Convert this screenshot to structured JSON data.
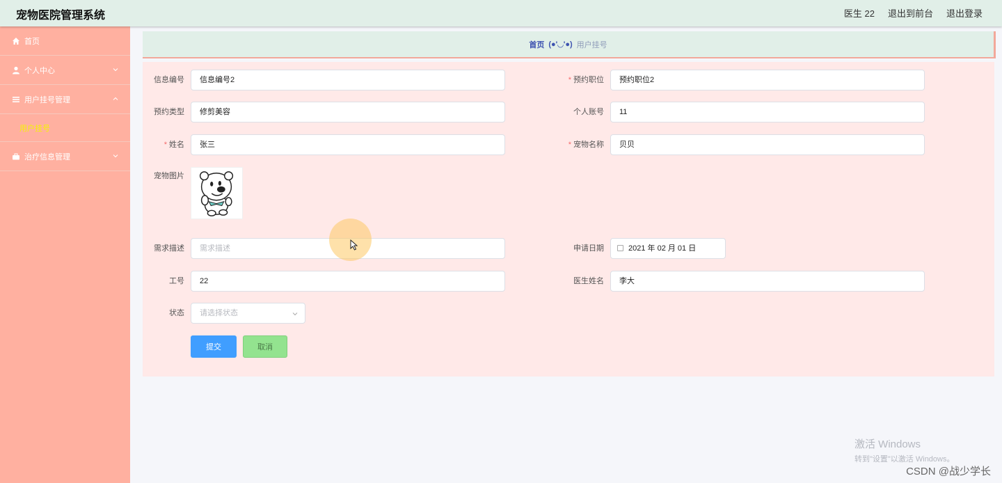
{
  "header": {
    "title": "宠物医院管理系统",
    "user_label": "医生 22",
    "back_to_front": "退出到前台",
    "logout": "退出登录"
  },
  "sidebar": {
    "items": [
      {
        "label": "首页",
        "icon": "home-icon"
      },
      {
        "label": "个人中心",
        "icon": "user-icon"
      },
      {
        "label": "用户挂号管理",
        "icon": "list-icon",
        "expanded": true,
        "sub": [
          {
            "label": "用户挂号",
            "active": true
          }
        ]
      },
      {
        "label": "治疗信息管理",
        "icon": "briefcase-icon"
      }
    ]
  },
  "breadcrumb": {
    "home": "首页",
    "separator": "(●'◡'●)",
    "current": "用户挂号"
  },
  "form": {
    "info_no": {
      "label": "信息编号",
      "value": "信息编号2"
    },
    "position": {
      "label": "预约职位",
      "value": "预约职位2",
      "required": true
    },
    "appt_type": {
      "label": "预约类型",
      "value": "修剪美容"
    },
    "account": {
      "label": "个人账号",
      "value": "11"
    },
    "name": {
      "label": "姓名",
      "value": "张三",
      "required": true
    },
    "pet_name": {
      "label": "宠物名称",
      "value": "贝贝",
      "required": true
    },
    "pet_image": {
      "label": "宠物图片"
    },
    "needs": {
      "label": "需求描述",
      "value": "",
      "placeholder": "需求描述"
    },
    "apply_date": {
      "label": "申请日期",
      "value": "2021 年 02 月 01 日"
    },
    "staff_no": {
      "label": "工号",
      "value": "22"
    },
    "doctor_name": {
      "label": "医生姓名",
      "value": "李大"
    },
    "status": {
      "label": "状态",
      "placeholder": "请选择状态"
    },
    "submit_label": "提交",
    "cancel_label": "取消"
  },
  "watermark": {
    "title": "激活 Windows",
    "subtitle": "转到\"设置\"以激活 Windows。"
  },
  "credit": "CSDN @战少学长",
  "colors": {
    "header_bg": "#e1efe8",
    "sidebar_bg": "#ffb0a0",
    "panel_bg": "#ffe9e8",
    "primary_button": "#409eff",
    "cancel_button": "#93e38f",
    "active_menu_text": "#f5f500"
  }
}
